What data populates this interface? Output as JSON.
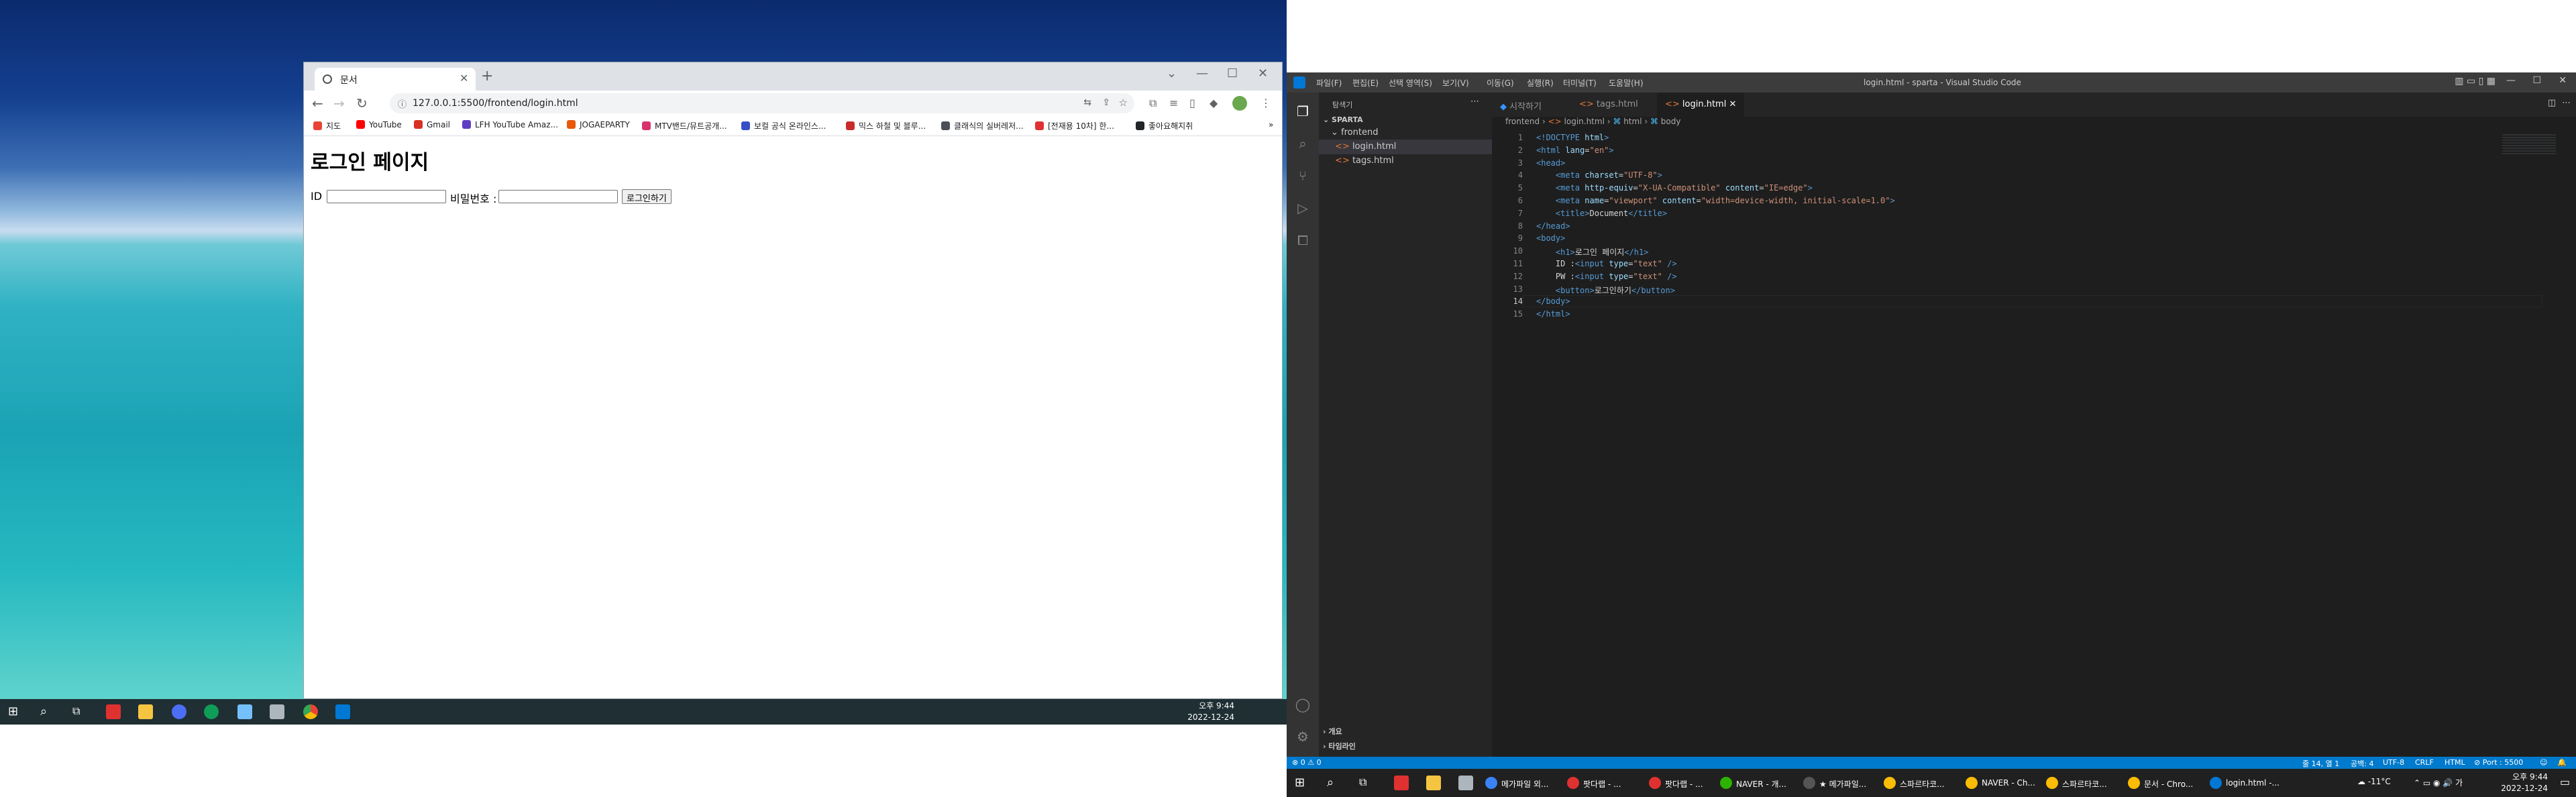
{
  "browser": {
    "tab_title": "문서",
    "url": "127.0.0.1:5500/frontend/login.html",
    "bookmarks": [
      {
        "label": "지도",
        "icon": "map-pin-icon",
        "color": "#ea4335"
      },
      {
        "label": "YouTube",
        "icon": "youtube-icon",
        "color": "#ff0000"
      },
      {
        "label": "Gmail",
        "icon": "gmail-icon",
        "color": "#d93025"
      },
      {
        "label": "LFH YouTube Amaz...",
        "icon": "video-icon",
        "color": "#5f3dc4"
      },
      {
        "label": "JOGAEPARTY",
        "icon": "party-icon",
        "color": "#e8590c"
      },
      {
        "label": "MTV밴드/뮤트공개...",
        "icon": "band-icon",
        "color": "#d6336c"
      },
      {
        "label": "보컬 공식 온라인스...",
        "icon": "globe-icon",
        "color": "#364fc7"
      },
      {
        "label": "믹스 하철 및 블루...",
        "icon": "music-icon",
        "color": "#c92a2a"
      },
      {
        "label": "클래식의 실버레저...",
        "icon": "circle-icon",
        "color": "#495057"
      },
      {
        "label": "[전재용 10차] 한...",
        "icon": "heart-pin-icon",
        "color": "#e03131"
      },
      {
        "label": "좋아요해지취",
        "icon": "cloud-icon",
        "color": "#212529"
      }
    ],
    "page": {
      "heading": "로그인 페이지",
      "id_label": "ID :",
      "pw_label": "비밀번호 :",
      "button": "로그인하기"
    }
  },
  "left_taskbar": {
    "time": "오후 9:44",
    "date": "2022-12-24"
  },
  "vscode": {
    "title": "login.html - sparta - Visual Studio Code",
    "menu": [
      "파일(F)",
      "편집(E)",
      "선택 영역(S)",
      "보기(V)",
      "이동(G)",
      "실행(R)",
      "터미널(T)",
      "도움말(H)"
    ],
    "explorer_title": "탐색기",
    "workspace": "SPARTA",
    "folder": "frontend",
    "files": [
      "login.html",
      "tags.html"
    ],
    "outline": "개요",
    "timeline": "타임라인",
    "tabs": [
      {
        "label": "시작하기",
        "active": false
      },
      {
        "label": "tags.html",
        "active": false
      },
      {
        "label": "login.html",
        "active": true
      }
    ],
    "breadcrumb": [
      "frontend",
      "login.html",
      "html",
      "body"
    ],
    "cursor_line": 14,
    "status": {
      "errors": "⊗ 0 ⚠ 0",
      "position": "줄 14, 열 1",
      "spaces": "공백: 4",
      "encoding": "UTF-8",
      "eol": "CRLF",
      "language": "HTML",
      "port": "⊘ Port : 5500"
    }
  },
  "right_taskbar": {
    "items": [
      {
        "label": "메가파일 외...",
        "color": "#3b82f6"
      },
      {
        "label": "팟다랩 - ...",
        "color": "#e03131"
      },
      {
        "label": "팟다랩 - ...",
        "color": "#e03131"
      },
      {
        "label": "NAVER - 개...",
        "color": "#2db400"
      },
      {
        "label": "★ 메가파일...",
        "color": "#555555"
      },
      {
        "label": "스파르타코...",
        "color": "#fbbc05"
      },
      {
        "label": "NAVER - Ch...",
        "color": "#fbbc05"
      },
      {
        "label": "스파르타코...",
        "color": "#fbbc05"
      },
      {
        "label": "문서 - Chro...",
        "color": "#fbbc05"
      },
      {
        "label": "login.html -...",
        "color": "#0078d4"
      }
    ],
    "weather": "-11°C",
    "time": "오후 9:44",
    "date": "2022-12-24"
  }
}
